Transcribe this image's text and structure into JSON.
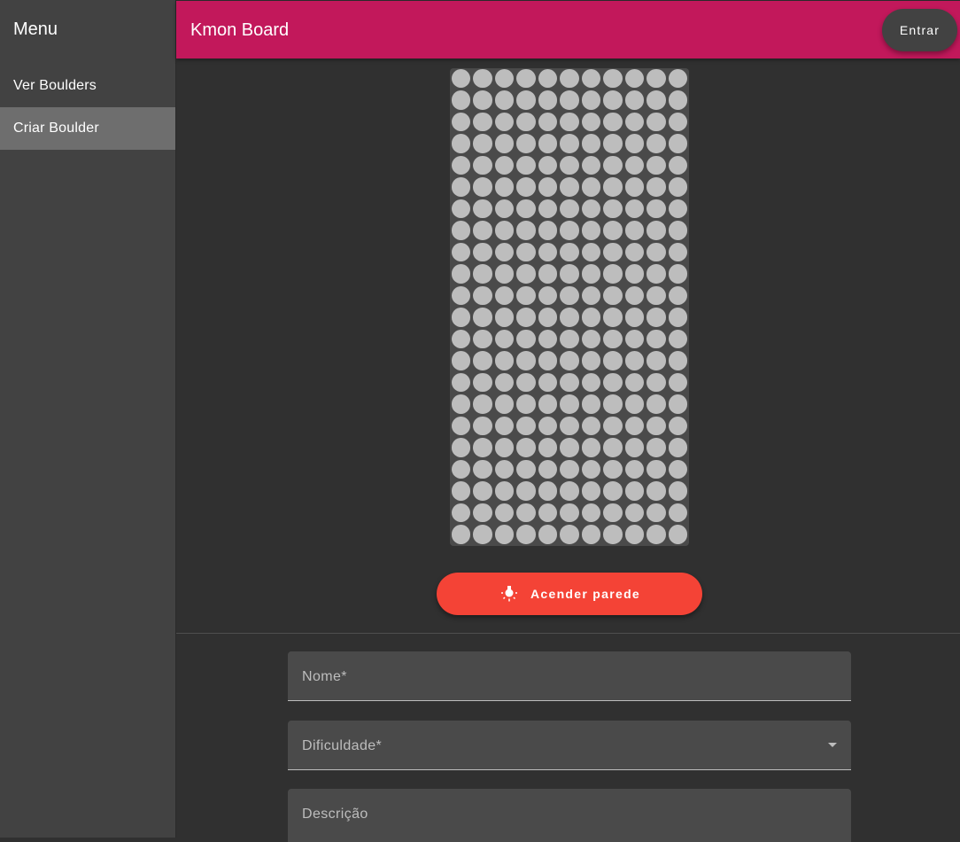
{
  "sidebar": {
    "title": "Menu",
    "items": [
      {
        "label": "Ver Boulders",
        "selected": false
      },
      {
        "label": "Criar Boulder",
        "selected": true
      }
    ]
  },
  "header": {
    "title": "Kmon Board",
    "login_label": "Entrar"
  },
  "board": {
    "columns": 11,
    "rows": 22,
    "hold_color": "#bdbdbd"
  },
  "actions": {
    "light_wall_label": "Acender parede",
    "light_wall_icon": "lightbulb-icon"
  },
  "form": {
    "name_label": "Nome*",
    "difficulty_label": "Dificuldade*",
    "description_label": "Descrição"
  },
  "colors": {
    "app_bar": "#c2185b",
    "accent_button": "#f44336",
    "background": "#303030",
    "sidebar": "#424242",
    "selected_item": "#6e6e6e"
  }
}
